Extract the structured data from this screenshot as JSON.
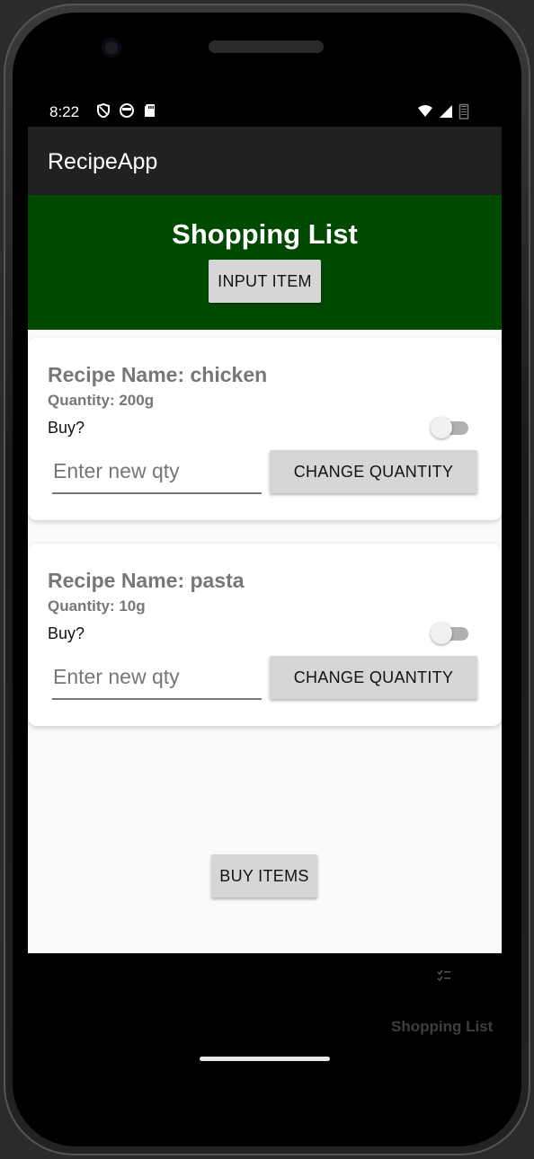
{
  "status_bar": {
    "time": "8:22",
    "left_icons": [
      "shield-icon",
      "face-icon",
      "sd-card-icon"
    ],
    "right_icons": [
      "wifi-icon",
      "signal-icon",
      "battery-icon"
    ]
  },
  "app_bar": {
    "title": "RecipeApp"
  },
  "header": {
    "title": "Shopping List",
    "input_item_label": "INPUT ITEM",
    "background_color": "#004a00"
  },
  "items": [
    {
      "recipe_name": "Recipe Name: chicken",
      "quantity": "Quantity: 200g",
      "buy_label": "Buy?",
      "buy_checked": false,
      "qty_placeholder": "Enter new qty",
      "change_label": "CHANGE QUANTITY"
    },
    {
      "recipe_name": "Recipe Name: pasta",
      "quantity": "Quantity: 10g",
      "buy_label": "Buy?",
      "buy_checked": false,
      "qty_placeholder": "Enter new qty",
      "change_label": "CHANGE QUANTITY"
    }
  ],
  "buy_items_label": "BUY ITEMS",
  "bottom_nav": {
    "icon": "checklist-icon",
    "label": "Shopping List"
  }
}
